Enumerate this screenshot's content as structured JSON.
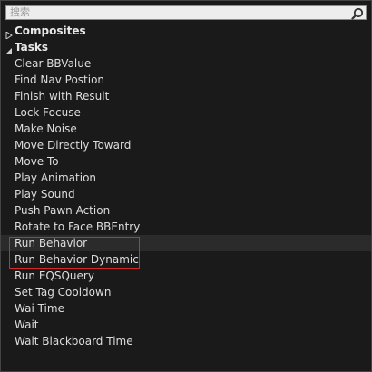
{
  "search": {
    "placeholder": "搜索",
    "icon": "search-icon"
  },
  "categories": [
    {
      "label": "Composites",
      "expanded": false
    },
    {
      "label": "Tasks",
      "expanded": true
    }
  ],
  "tasks": [
    "Clear BBValue",
    "Find Nav Postion",
    "Finish with Result",
    "Lock Focuse",
    "Make Noise",
    "Move Directly Toward",
    "Move To",
    "Play Animation",
    "Play Sound",
    "Push Pawn Action",
    "Rotate to Face BBEntry",
    "Run Behavior",
    "Run Behavior Dynamic",
    "Run EQSQuery",
    "Set Tag Cooldown",
    "Wai Time",
    "Wait",
    "Wait Blackboard Time"
  ],
  "colors": {
    "highlight": "#d12b2b",
    "background": "#1a1a1a",
    "text": "#dddddd"
  }
}
